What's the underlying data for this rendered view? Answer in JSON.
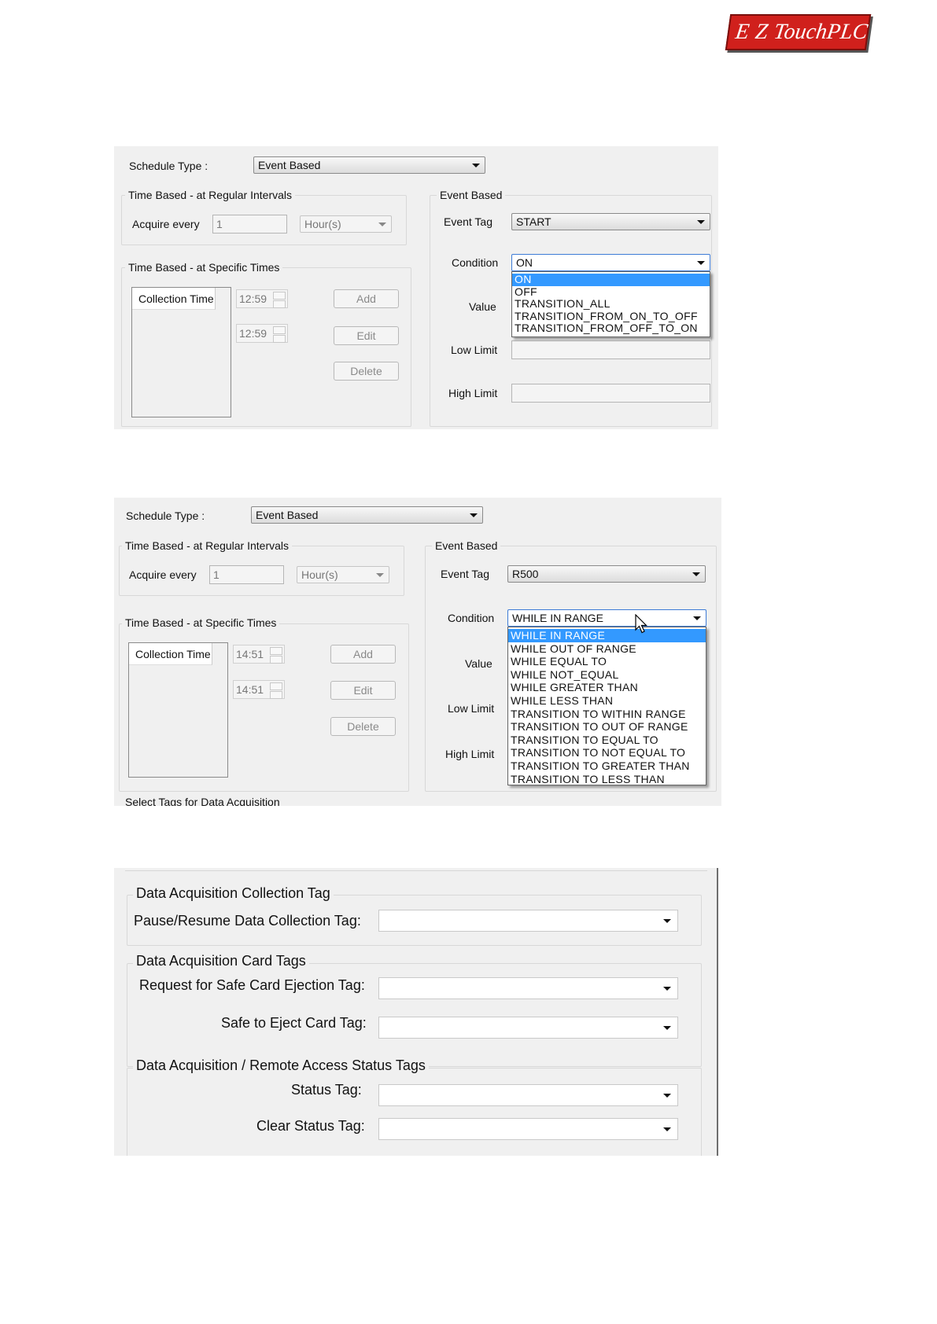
{
  "logo": {
    "part1": "E",
    "part2": "Z",
    "part3": "TouchPLC"
  },
  "dialog1": {
    "schedule_type_label": "Schedule Type :",
    "schedule_type_value": "Event Based",
    "regular_group_title": "Time Based - at Regular Intervals",
    "acquire_every_label": "Acquire every",
    "acquire_every_value": "1",
    "acquire_unit": "Hour(s)",
    "specific_group_title": "Time Based - at Specific Times",
    "collection_time_header": "Collection Time",
    "time_1": "12:59",
    "time_2": "12:59",
    "add_label": "Add",
    "edit_label": "Edit",
    "delete_label": "Delete",
    "event_group_title": "Event Based",
    "event_tag_label": "Event Tag",
    "event_tag_value": "START",
    "condition_label": "Condition",
    "condition_value": "ON",
    "value_label": "Value",
    "low_limit_label": "Low Limit",
    "high_limit_label": "High Limit",
    "dropdown_options": [
      "ON",
      "OFF",
      "TRANSITION_ALL",
      "TRANSITION_FROM_ON_TO_OFF",
      "TRANSITION_FROM_OFF_TO_ON"
    ]
  },
  "dialog2": {
    "schedule_type_label": "Schedule Type :",
    "schedule_type_value": "Event Based",
    "regular_group_title": "Time Based - at Regular Intervals",
    "acquire_every_label": "Acquire every",
    "acquire_every_value": "1",
    "acquire_unit": "Hour(s)",
    "specific_group_title": "Time Based - at Specific Times",
    "collection_time_header": "Collection Time",
    "time_1": "14:51",
    "time_2": "14:51",
    "add_label": "Add",
    "edit_label": "Edit",
    "delete_label": "Delete",
    "event_group_title": "Event Based",
    "event_tag_label": "Event Tag",
    "event_tag_value": "R500",
    "condition_label": "Condition",
    "condition_value": "WHILE IN RANGE",
    "value_label": "Value",
    "low_limit_label": "Low Limit",
    "high_limit_label": "High Limit",
    "select_tags_label": "Select Tags for Data Acquisition",
    "dropdown_options": [
      "WHILE IN RANGE",
      "WHILE OUT OF RANGE",
      "WHILE EQUAL TO",
      "WHILE NOT_EQUAL",
      "WHILE GREATER THAN",
      "WHILE LESS THAN",
      "TRANSITION TO WITHIN RANGE",
      "TRANSITION TO OUT OF RANGE",
      "TRANSITION TO EQUAL TO",
      "TRANSITION TO NOT EQUAL TO",
      "TRANSITION TO GREATER THAN",
      "TRANSITION TO LESS THAN"
    ]
  },
  "dialog3": {
    "collection_group_title": "Data Acquisition Collection Tag",
    "pause_resume_label": "Pause/Resume Data Collection Tag:",
    "card_group_title": "Data Acquisition Card Tags",
    "safe_card_request_label": "Request for Safe Card Ejection Tag:",
    "safe_to_eject_label": "Safe to Eject Card Tag:",
    "status_group_title": "Data Acquisition / Remote Access Status Tags",
    "status_tag_label": "Status Tag:",
    "clear_status_label": "Clear Status Tag:"
  }
}
